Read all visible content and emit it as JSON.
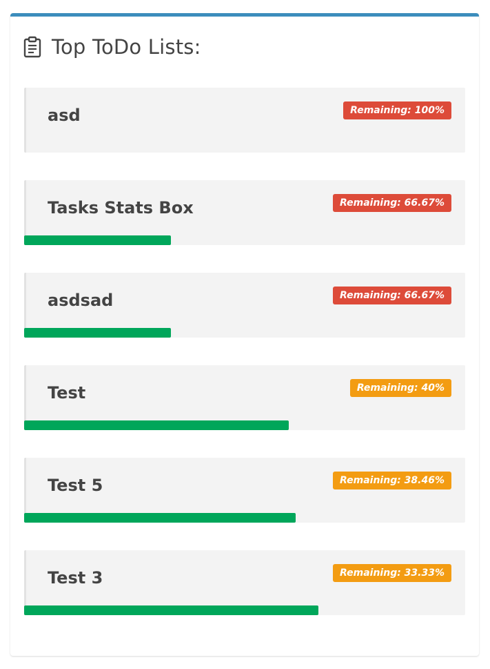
{
  "header": {
    "title": "Top ToDo Lists:",
    "icon": "clipboard-icon"
  },
  "colors": {
    "accent_border": "#3c8dbc",
    "badge_danger": "#dd4b39",
    "badge_warning": "#f39c12",
    "progress": "#00a65a"
  },
  "todo_lists": [
    {
      "name": "asd",
      "remaining_label": "Remaining: 100%",
      "remaining_percent": 100,
      "status": "danger"
    },
    {
      "name": "Tasks Stats Box",
      "remaining_label": "Remaining: 66.67%",
      "remaining_percent": 66.67,
      "status": "danger"
    },
    {
      "name": "asdsad",
      "remaining_label": "Remaining: 66.67%",
      "remaining_percent": 66.67,
      "status": "danger"
    },
    {
      "name": "Test",
      "remaining_label": "Remaining: 40%",
      "remaining_percent": 40,
      "status": "warning"
    },
    {
      "name": "Test 5",
      "remaining_label": "Remaining: 38.46%",
      "remaining_percent": 38.46,
      "status": "warning"
    },
    {
      "name": "Test 3",
      "remaining_label": "Remaining: 33.33%",
      "remaining_percent": 33.33,
      "status": "warning"
    }
  ]
}
